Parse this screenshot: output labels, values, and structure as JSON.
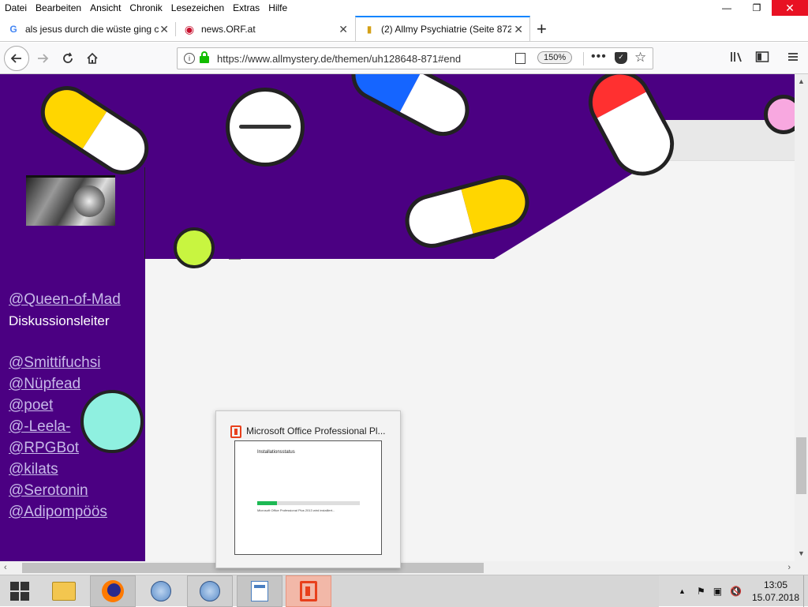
{
  "menu": [
    "Datei",
    "Bearbeiten",
    "Ansicht",
    "Chronik",
    "Lesezeichen",
    "Extras",
    "Hilfe"
  ],
  "window_controls": {
    "minimize": "—",
    "restore": "❐",
    "close": "✕"
  },
  "tabs": [
    {
      "title": "als jesus durch die wüste ging c",
      "icon": "G",
      "active": false
    },
    {
      "title": "news.ORF.at",
      "icon": "◉",
      "active": false
    },
    {
      "title": "(2) Allmy Psychiatrie (Seite 872)",
      "icon": "▮",
      "active": true
    }
  ],
  "new_tab_label": "+",
  "nav": {
    "url": "https://www.allmystery.de/themen/uh128648-871#end",
    "url_host": "allmystery.de",
    "zoom": "150%"
  },
  "sidebar": {
    "lead_mention": "@Queen-of-Mad",
    "lead_role": "Diskussionsleiter",
    "mentions": [
      "@Smittifuchsi",
      "@Nüpfead",
      "@poet",
      "@-Leela-",
      "@RPGBot",
      "@kilats",
      "@Serotonin",
      "@Adipompöös"
    ]
  },
  "preview": {
    "title": "Microsoft Office Professional Pl...",
    "status": "Installationsstatus",
    "message": "Microsoft Office Professional Plus 2013 wird installiert...",
    "progress": 0.19
  },
  "clock": {
    "time": "13:05",
    "date": "15.07.2018"
  },
  "colors": {
    "purple": "#4b0082",
    "accent": "#0a84ff",
    "lock_green": "#12bc00",
    "office_red": "#e8401c"
  }
}
